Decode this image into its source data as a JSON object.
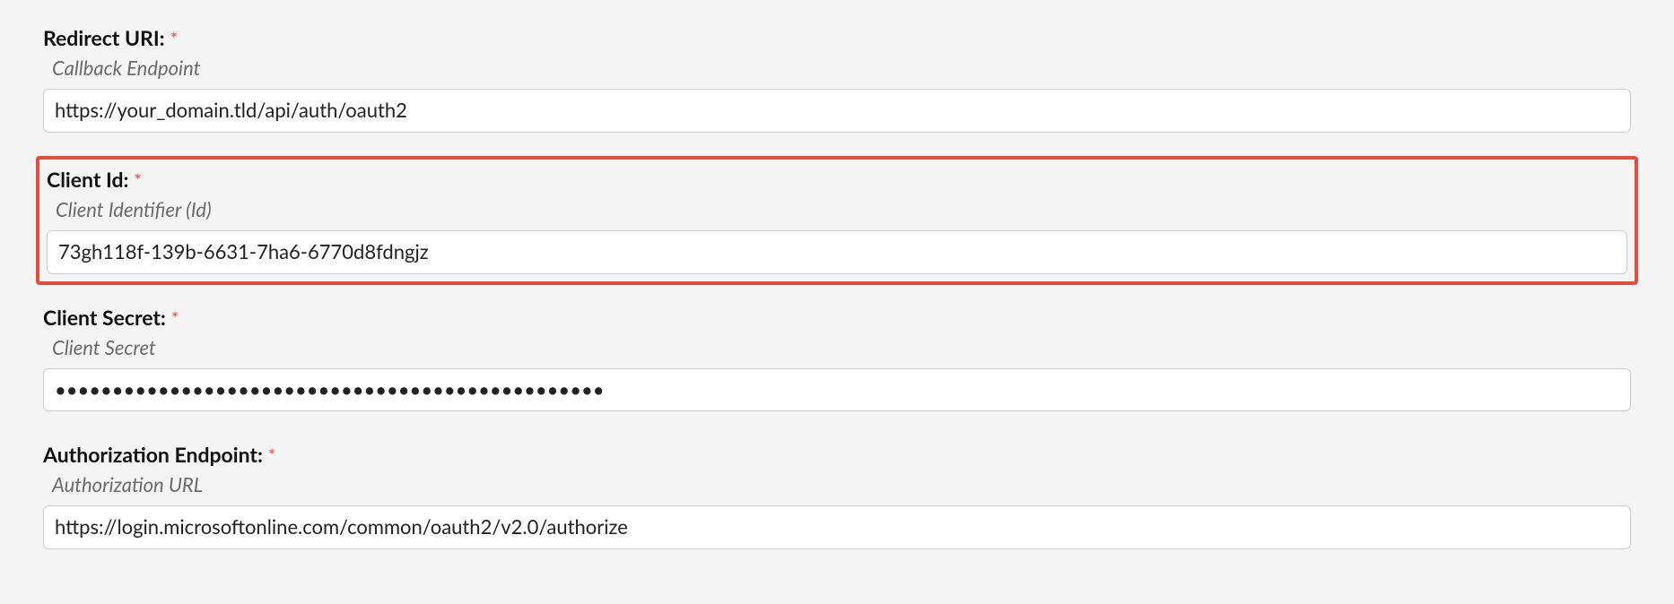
{
  "fields": [
    {
      "label": "Redirect URI:",
      "required": "*",
      "description": "Callback Endpoint",
      "value": "https://your_domain.tld/api/auth/oauth2",
      "type": "text",
      "highlighted": false
    },
    {
      "label": "Client Id:",
      "required": "*",
      "description": "Client Identifier (Id)",
      "value": "73gh118f-139b-6631-7ha6-6770d8fdngjz",
      "type": "text",
      "highlighted": true
    },
    {
      "label": "Client Secret:",
      "required": "*",
      "description": "Client Secret",
      "value": "••••••••••••••••••••••••••••••••••••••••••••••••",
      "type": "password",
      "highlighted": false
    },
    {
      "label": "Authorization Endpoint:",
      "required": "*",
      "description": "Authorization URL",
      "value": "https://login.microsoftonline.com/common/oauth2/v2.0/authorize",
      "type": "text",
      "highlighted": false
    }
  ]
}
